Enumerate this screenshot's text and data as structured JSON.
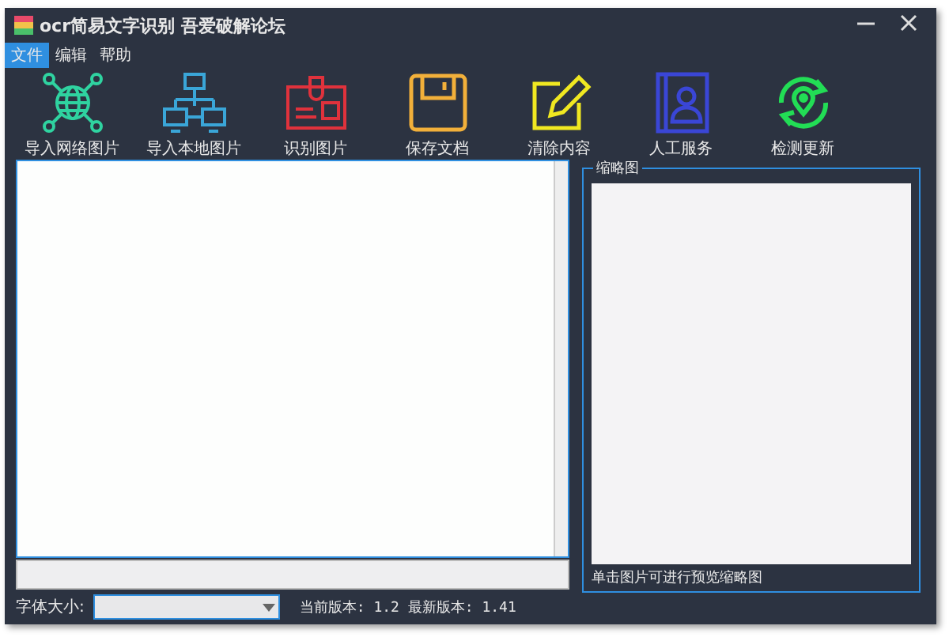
{
  "window": {
    "title": "ocr简易文字识别 吾爱破解论坛"
  },
  "menu": [
    {
      "label": "文件",
      "selected": true
    },
    {
      "label": "编辑",
      "selected": false
    },
    {
      "label": "帮助",
      "selected": false
    }
  ],
  "toolbar": [
    {
      "label": "导入网络图片",
      "kind": "globe"
    },
    {
      "label": "导入本地图片",
      "kind": "network"
    },
    {
      "label": "识别图片",
      "kind": "card"
    },
    {
      "label": "保存文档",
      "kind": "save"
    },
    {
      "label": "清除内容",
      "kind": "edit"
    },
    {
      "label": "人工服务",
      "kind": "contact"
    },
    {
      "label": "检测更新",
      "kind": "update"
    }
  ],
  "thumbnail": {
    "title": "缩略图",
    "hint": "单击图片可进行预览缩略图"
  },
  "font_size": {
    "label": "字体大小:"
  },
  "version": {
    "text": "当前版本: 1.2 最新版本: 1.41"
  }
}
